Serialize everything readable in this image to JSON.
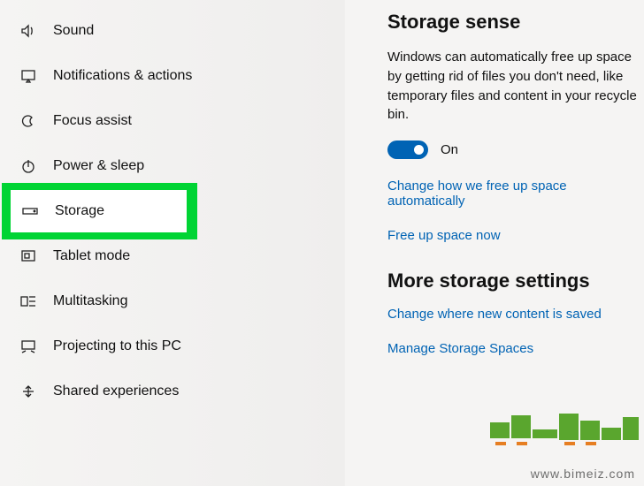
{
  "sidebar": {
    "items": [
      {
        "label": "Sound"
      },
      {
        "label": "Notifications & actions"
      },
      {
        "label": "Focus assist"
      },
      {
        "label": "Power & sleep"
      },
      {
        "label": "Storage"
      },
      {
        "label": "Tablet mode"
      },
      {
        "label": "Multitasking"
      },
      {
        "label": "Projecting to this PC"
      },
      {
        "label": "Shared experiences"
      }
    ],
    "selected_index": 4
  },
  "main": {
    "storage_sense": {
      "title": "Storage sense",
      "description": "Windows can automatically free up space by getting rid of files you don't need, like temporary files and content in your recycle bin.",
      "toggle_state": "On",
      "link_change": "Change how we free up space automatically",
      "link_free": "Free up space now"
    },
    "more_storage": {
      "title": "More storage settings",
      "link_content": "Change where new content is saved",
      "link_spaces": "Manage Storage Spaces"
    }
  },
  "colors": {
    "accent": "#0063b4",
    "link": "#0063b4",
    "highlight": "#00d434"
  },
  "watermark": "www.bimeiz.com"
}
